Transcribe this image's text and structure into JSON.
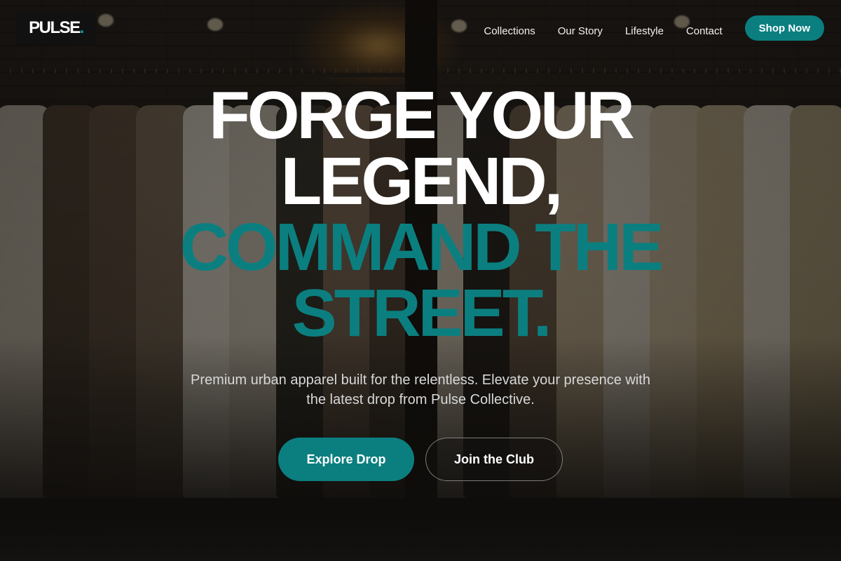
{
  "header": {
    "logo_text": "PULSE",
    "logo_dot": ".",
    "nav": [
      {
        "label": "Collections"
      },
      {
        "label": "Our Story"
      },
      {
        "label": "Lifestyle"
      },
      {
        "label": "Contact"
      }
    ],
    "cta_label": "Shop Now"
  },
  "hero": {
    "line1": "FORGE YOUR",
    "line2": "LEGEND,",
    "line3": "COMMAND THE",
    "line4": "STREET.",
    "subtitle": "Premium urban apparel built for the relentless. Elevate your presence with the latest drop from Pulse Collective.",
    "primary_cta": "Explore Drop",
    "secondary_cta": "Join the Club"
  },
  "colors": {
    "accent": "#0b7f80",
    "heading": "#ffffff",
    "logo_bg": "#111111"
  },
  "icons": {
    "background": "clothing-rack-photo"
  }
}
